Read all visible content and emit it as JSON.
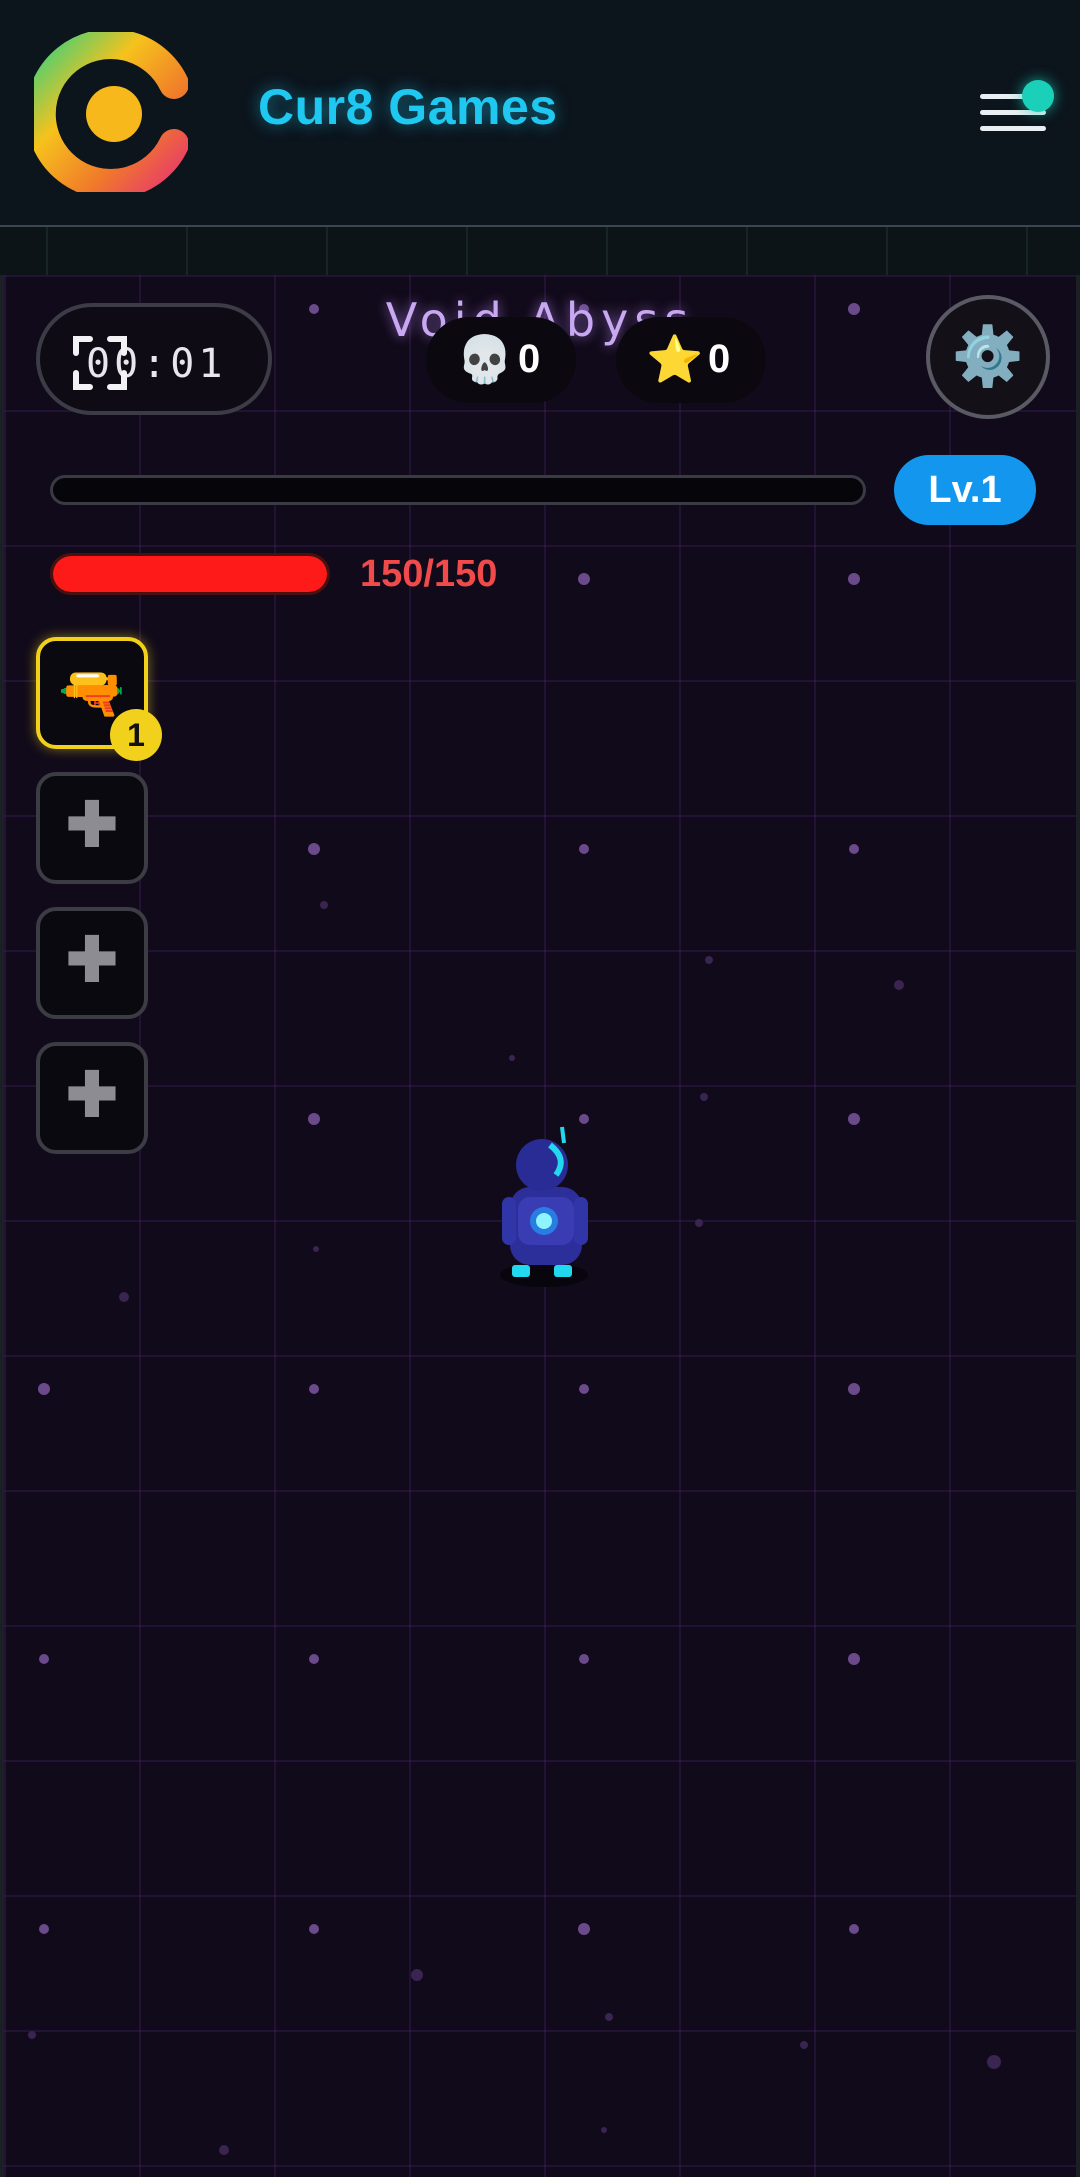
{
  "header": {
    "brand": "Cur8 Games",
    "logo_icon": "cur8-logo-icon",
    "menu_icon": "hamburger-menu-icon"
  },
  "game": {
    "title": "Void Abyss",
    "timer": "00:01",
    "fullscreen_icon": "fullscreen-icon",
    "kills": {
      "icon": "💀",
      "value": "0"
    },
    "stars": {
      "icon": "⭐",
      "value": "0"
    },
    "settings_icon": "⚙️",
    "xp_progress": 0,
    "level_label": "Lv.1",
    "health": {
      "current": 150,
      "max": 150,
      "label": "150/150"
    },
    "weapon_slots": [
      {
        "icon": "🔫",
        "level": "1",
        "filled": true
      },
      {
        "icon": "➕",
        "filled": false
      },
      {
        "icon": "➕",
        "filled": false
      },
      {
        "icon": "➕",
        "filled": false
      }
    ]
  },
  "colors": {
    "brand": "#1fc8f0",
    "level_badge": "#1296ee",
    "health": "#ff1a1a",
    "slot_active": "#f2d11c",
    "title_glow": "#c8a8f0"
  }
}
